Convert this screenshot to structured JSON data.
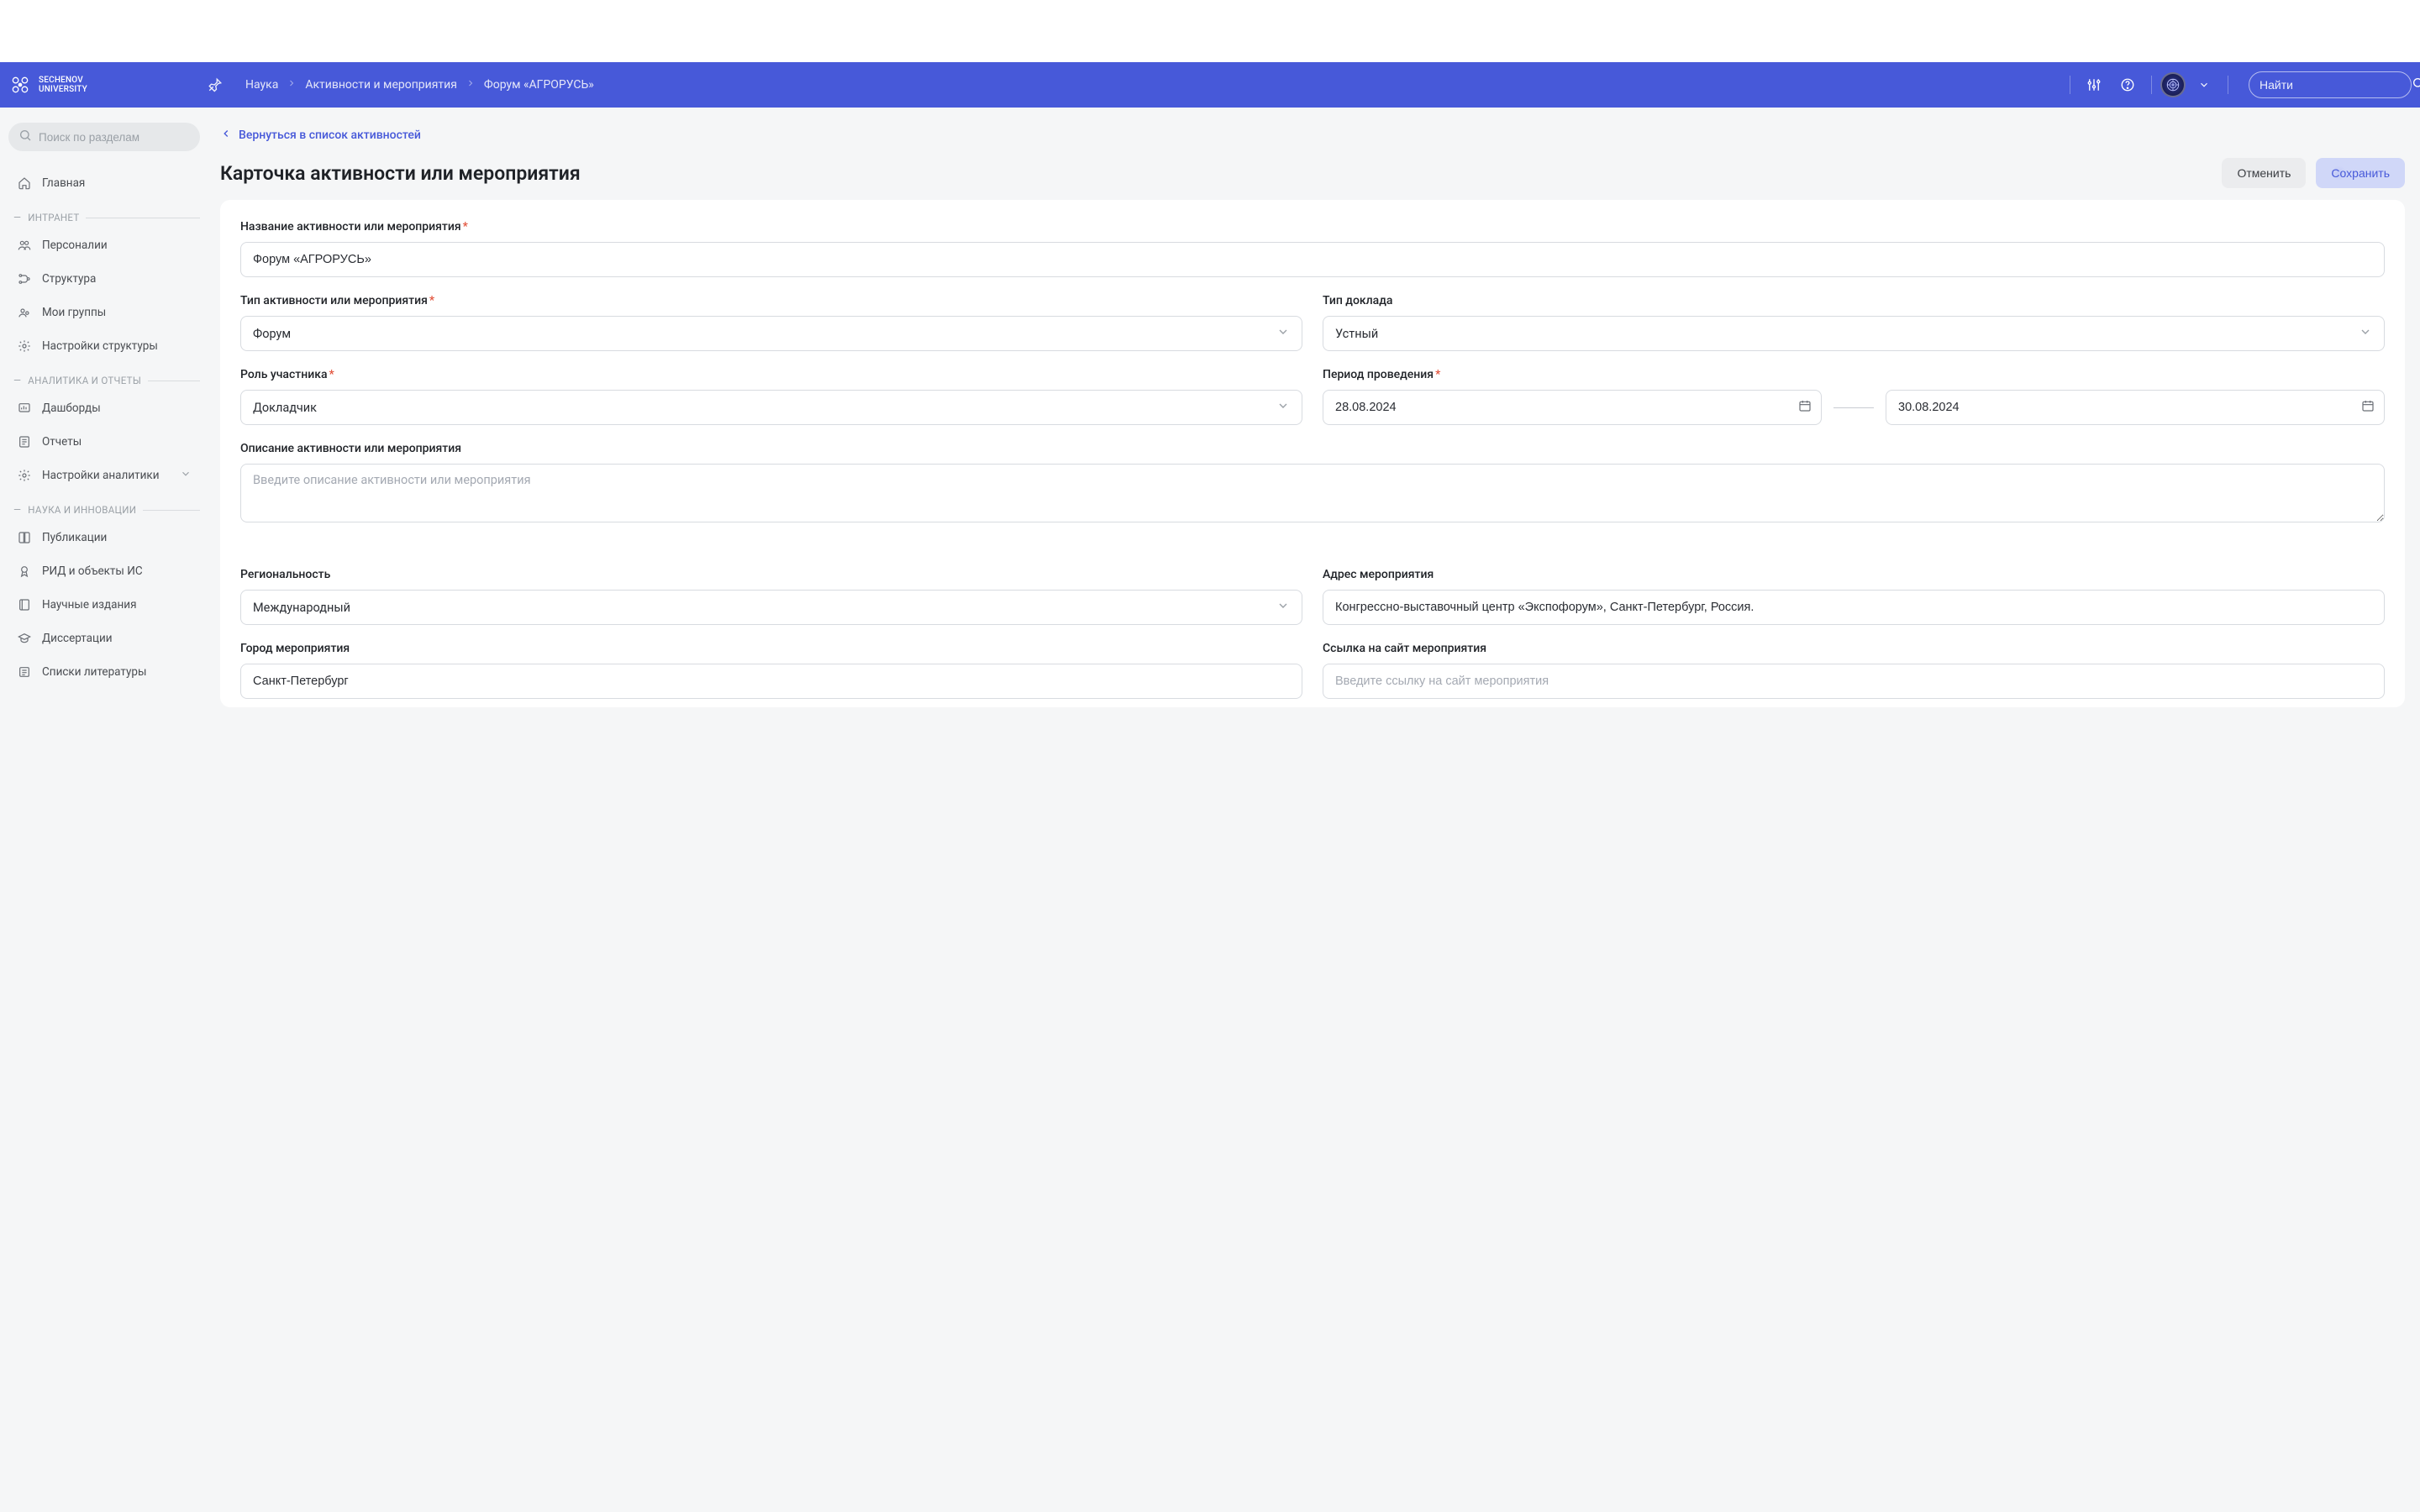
{
  "brand": {
    "line1": "SECHENOV",
    "line2": "UNIVERSITY"
  },
  "header": {
    "search_placeholder": "Найти"
  },
  "breadcrumb": [
    "Наука",
    "Активности и мероприятия",
    "Форум «АГРОРУСЬ»"
  ],
  "sidebar": {
    "search_placeholder": "Поиск по разделам",
    "top_item": "Главная",
    "sections": [
      {
        "title": "ИНТРАНЕТ",
        "items": [
          "Персоналии",
          "Структура",
          "Мои группы",
          "Настройки структуры"
        ]
      },
      {
        "title": "АНАЛИТИКА И ОТЧЕТЫ",
        "items": [
          "Дашборды",
          "Отчеты",
          "Настройки аналитики"
        ]
      },
      {
        "title": "НАУКА И ИННОВАЦИИ",
        "items": [
          "Публикации",
          "РИД и объекты ИС",
          "Научные издания",
          "Диссертации",
          "Списки литературы"
        ]
      }
    ]
  },
  "main": {
    "back_label": "Вернуться в список активностей",
    "title": "Карточка активности или мероприятия",
    "buttons": {
      "cancel": "Отменить",
      "save": "Сохранить"
    },
    "fields": {
      "name_label": "Название активности или мероприятия",
      "name_value": "Форум «АГРОРУСЬ»",
      "type_label": "Тип активности или мероприятия",
      "type_value": "Форум",
      "report_type_label": "Тип доклада",
      "report_type_value": "Устный",
      "role_label": "Роль участника",
      "role_value": "Докладчик",
      "period_label": "Период проведения",
      "period_from": "28.08.2024",
      "period_to": "30.08.2024",
      "description_label": "Описание активности или мероприятия",
      "description_placeholder": "Введите описание активности или мероприятия",
      "regionality_label": "Региональность",
      "regionality_value": "Международный",
      "address_label": "Адрес мероприятия",
      "address_value": "Конгрессно-выставочный центр «Экспофорум», Санкт-Петербург, Россия.",
      "city_label": "Город мероприятия",
      "city_value": "Санкт-Петербург",
      "link_label": "Ссылка на сайт мероприятия",
      "link_placeholder": "Введите ссылку на сайт мероприятия"
    }
  }
}
